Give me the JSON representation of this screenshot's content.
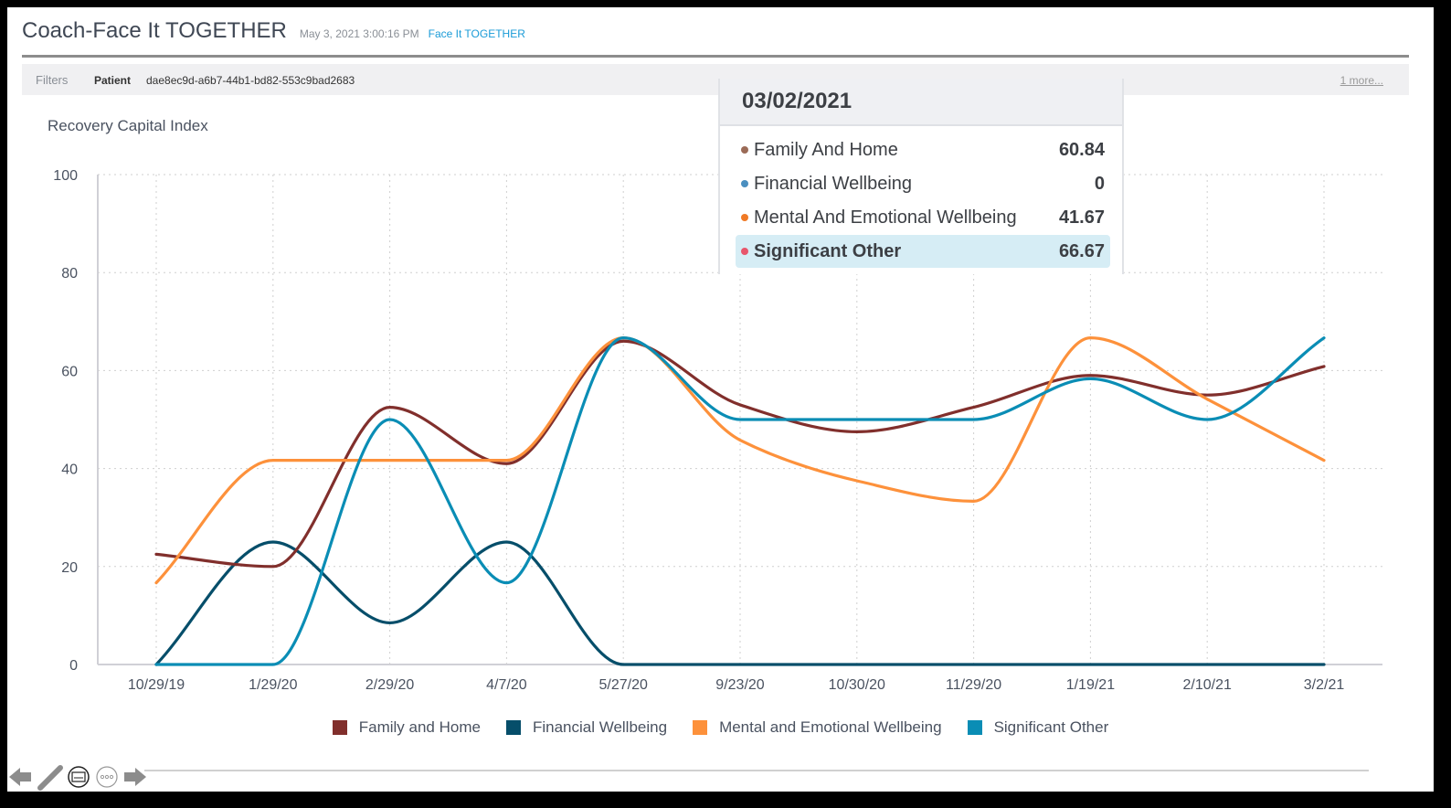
{
  "header": {
    "title": "Coach-Face It TOGETHER",
    "timestamp": "May 3, 2021 3:00:16 PM",
    "link": "Face It TOGETHER"
  },
  "filters": {
    "label": "Filters",
    "field": "Patient",
    "value": "dae8ec9d-a6b7-44b1-bd82-553c9bad2683",
    "more": "1 more..."
  },
  "tooltip": {
    "date": "03/02/2021",
    "rows": [
      {
        "label": "Family And Home",
        "value": "60.84",
        "color": "#9b6b57"
      },
      {
        "label": "Financial Wellbeing",
        "value": "0",
        "color": "#4a8fc0"
      },
      {
        "label": "Mental And Emotional Wellbeing",
        "value": "41.67",
        "color": "#f07a26"
      },
      {
        "label": "Significant Other",
        "value": "66.67",
        "color": "#e8556b",
        "highlighted": true
      }
    ]
  },
  "chart_data": {
    "type": "line",
    "title": "Recovery Capital Index",
    "xlabel": "",
    "ylabel": "",
    "ylim": [
      0,
      100
    ],
    "yticks": [
      0,
      20,
      40,
      60,
      80,
      100
    ],
    "grid": true,
    "smooth": true,
    "legend": "bottom",
    "categories": [
      "10/29/19",
      "1/29/20",
      "2/29/20",
      "4/7/20",
      "5/27/20",
      "9/23/20",
      "10/30/20",
      "11/29/20",
      "1/19/21",
      "2/10/21",
      "3/2/21"
    ],
    "series": [
      {
        "name": "Family and Home",
        "color": "#812f2c",
        "values": [
          22.5,
          20,
          52.5,
          41,
          66,
          53,
          47.5,
          52.5,
          59,
          55,
          60.84
        ]
      },
      {
        "name": "Financial Wellbeing",
        "color": "#064e6a",
        "values": [
          0,
          25,
          8.5,
          25,
          0,
          0,
          0,
          0,
          0,
          0,
          0
        ]
      },
      {
        "name": "Mental and Emotional Wellbeing",
        "color": "#fd913b",
        "values": [
          16.67,
          41.67,
          41.67,
          41.67,
          66.67,
          45.8,
          37.5,
          33.33,
          66.67,
          54.17,
          41.67
        ]
      },
      {
        "name": "Significant Other",
        "color": "#0a8db5",
        "values": [
          0,
          0,
          50,
          16.67,
          66.67,
          50,
          50,
          50,
          58.33,
          50,
          66.67
        ]
      }
    ]
  }
}
